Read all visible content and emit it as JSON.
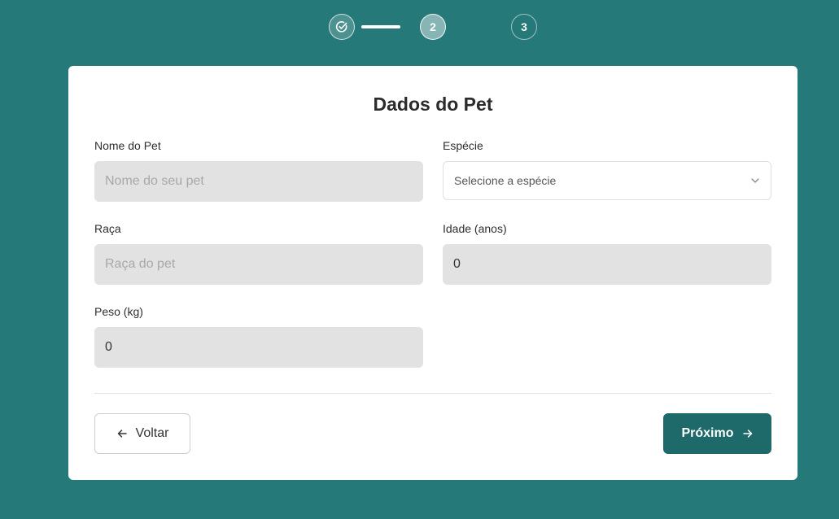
{
  "stepper": {
    "steps": [
      {
        "label": "",
        "state": "completed",
        "icon": "check-circle-icon"
      },
      {
        "label": "2",
        "state": "current"
      },
      {
        "label": "3",
        "state": "upcoming"
      }
    ]
  },
  "form": {
    "title": "Dados do Pet",
    "pet_name": {
      "label": "Nome do Pet",
      "placeholder": "Nome do seu pet",
      "value": ""
    },
    "species": {
      "label": "Espécie",
      "selected": "Selecione a espécie",
      "icon": "chevron-down-icon"
    },
    "breed": {
      "label": "Raça",
      "placeholder": "Raça do pet",
      "value": ""
    },
    "age": {
      "label": "Idade (anos)",
      "value": "0"
    },
    "weight": {
      "label": "Peso (kg)",
      "value": "0"
    }
  },
  "actions": {
    "back_label": "Voltar",
    "back_icon": "arrow-left-icon",
    "next_label": "Próximo",
    "next_icon": "arrow-right-icon"
  },
  "colors": {
    "background": "#267979",
    "primary_button": "#1e6a6a",
    "input_fill": "#e2e2e2"
  }
}
